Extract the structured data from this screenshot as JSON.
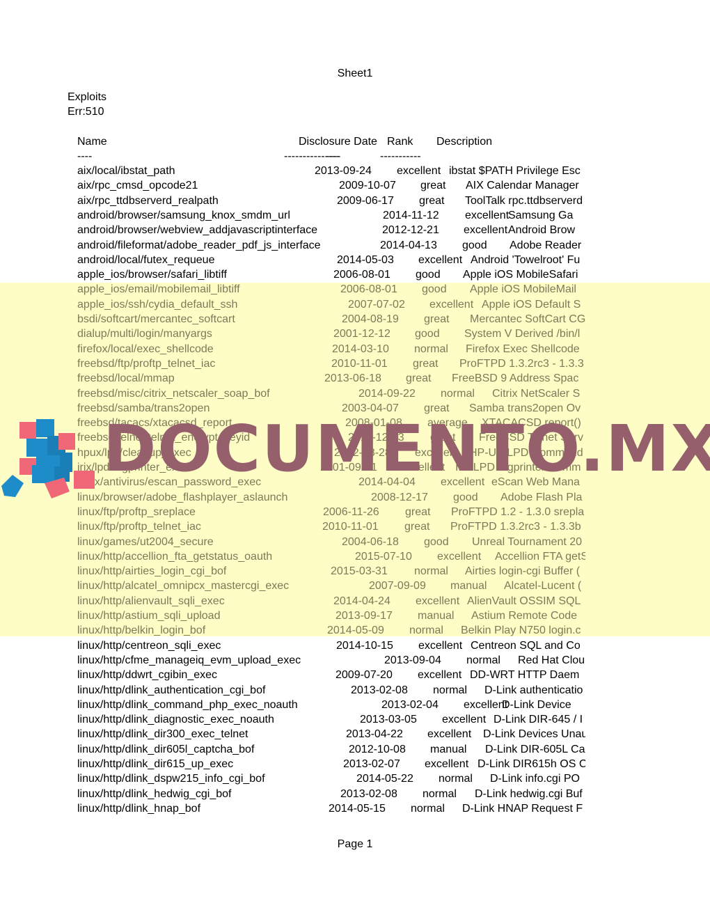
{
  "document": {
    "sheet_title": "Sheet1",
    "section_title": "Exploits",
    "error_cell": "Err:510",
    "footer": "Page 1",
    "highlight_color": "#fefdc6",
    "watermark": {
      "text": "DOCUMENTO.MX",
      "color": "#95606c",
      "logo": "stacked-cubes-logo"
    }
  },
  "table": {
    "headers": {
      "name": "Name",
      "date": "Disclosure Date",
      "rank": "Rank",
      "description": "Description"
    },
    "dashes": {
      "name": "----",
      "date": "---------------",
      "rank": "----",
      "description": "-----------"
    },
    "rows": [
      {
        "name": "aix/local/ibstat_path",
        "date": "2013-09-24",
        "rank": "excellent",
        "description": "ibstat $PATH Privilege Esc",
        "highlighted": false
      },
      {
        "name": "aix/rpc_cmsd_opcode21",
        "date": "2009-10-07",
        "rank": "great",
        "description": "AIX Calendar Manager",
        "highlighted": false
      },
      {
        "name": "aix/rpc_ttdbserverd_realpath",
        "date": "2009-06-17",
        "rank": "great",
        "description": "ToolTalk rpc.ttdbserverd",
        "highlighted": false
      },
      {
        "name": "android/browser/samsung_knox_smdm_url",
        "date": "2014-11-12",
        "rank": "excellent",
        "description": "Samsung Ga",
        "highlighted": false
      },
      {
        "name": "android/browser/webview_addjavascriptinterface",
        "date": "2012-12-21",
        "rank": "excellent",
        "description": "Android Brow",
        "highlighted": false
      },
      {
        "name": "android/fileformat/adobe_reader_pdf_js_interface",
        "date": "2014-04-13",
        "rank": "good",
        "description": "Adobe Reader",
        "highlighted": false
      },
      {
        "name": "android/local/futex_requeue",
        "date": "2014-05-03",
        "rank": "excellent",
        "description": "Android 'Towelroot' Fu",
        "highlighted": false
      },
      {
        "name": "apple_ios/browser/safari_libtiff",
        "date": "2006-08-01",
        "rank": "good",
        "description": "Apple iOS MobileSafari",
        "highlighted": false
      },
      {
        "name": "apple_ios/email/mobilemail_libtiff",
        "date": "2006-08-01",
        "rank": "good",
        "description": "Apple iOS MobileMail",
        "highlighted": true
      },
      {
        "name": "apple_ios/ssh/cydia_default_ssh",
        "date": "2007-07-02",
        "rank": "excellent",
        "description": "Apple iOS Default S",
        "highlighted": true
      },
      {
        "name": "bsdi/softcart/mercantec_softcart",
        "date": "2004-08-19",
        "rank": "great",
        "description": "Mercantec SoftCart CG",
        "highlighted": true
      },
      {
        "name": "dialup/multi/login/manyargs",
        "date": "2001-12-12",
        "rank": "good",
        "description": "System V Derived /bin/l",
        "highlighted": true
      },
      {
        "name": "firefox/local/exec_shellcode",
        "date": "2014-03-10",
        "rank": "normal",
        "description": "Firefox Exec Shellcode",
        "highlighted": true
      },
      {
        "name": "freebsd/ftp/proftp_telnet_iac",
        "date": "2010-11-01",
        "rank": "great",
        "description": "ProFTPD 1.3.2rc3 - 1.3.3",
        "highlighted": true
      },
      {
        "name": "freebsd/local/mmap",
        "date": "2013-06-18",
        "rank": "great",
        "description": "FreeBSD 9 Address Spac",
        "highlighted": true
      },
      {
        "name": "freebsd/misc/citrix_netscaler_soap_bof",
        "date": "2014-09-22",
        "rank": "normal",
        "description": "Citrix NetScaler S",
        "highlighted": true
      },
      {
        "name": "freebsd/samba/trans2open",
        "date": "2003-04-07",
        "rank": "great",
        "description": "Samba trans2open Ov",
        "highlighted": true
      },
      {
        "name": "freebsd/tacacs/xtacacsd_report",
        "date": "2008-01-08",
        "rank": "average",
        "description": "XTACACSD report()",
        "highlighted": true
      },
      {
        "name": "freebsd/telnet/telnet_encrypt_keyid",
        "date": "2011-12-23",
        "rank": "great",
        "description": "FreeBSD Telnet Serv",
        "highlighted": true
      },
      {
        "name": "hpux/lpd/cleanup_exec",
        "date": "2002-08-28",
        "rank": "excellent",
        "description": "HP-UX LPD Command",
        "highlighted": true
      },
      {
        "name": "irix/lpd/tagprinter_exec",
        "date": "2001-09-01",
        "rank": "excellent",
        "description": "Irix LPD tagprinter Comm",
        "highlighted": true
      },
      {
        "name": "linux/antivirus/escan_password_exec",
        "date": "2014-04-04",
        "rank": "excellent",
        "description": "eScan Web Mana",
        "highlighted": true
      },
      {
        "name": "linux/browser/adobe_flashplayer_aslaunch",
        "date": "2008-12-17",
        "rank": "good",
        "description": "Adobe Flash Pla",
        "highlighted": true
      },
      {
        "name": "linux/ftp/proftp_sreplace",
        "date": "2006-11-26",
        "rank": "great",
        "description": "ProFTPD 1.2 - 1.3.0 srepla",
        "highlighted": true
      },
      {
        "name": "linux/ftp/proftp_telnet_iac",
        "date": "2010-11-01",
        "rank": "great",
        "description": "ProFTPD 1.3.2rc3 - 1.3.3b",
        "highlighted": true
      },
      {
        "name": "linux/games/ut2004_secure",
        "date": "2004-06-18",
        "rank": "good",
        "description": "Unreal Tournament 20",
        "highlighted": true
      },
      {
        "name": "linux/http/accellion_fta_getstatus_oauth",
        "date": "2015-07-10",
        "rank": "excellent",
        "description": "Accellion FTA getS",
        "highlighted": true
      },
      {
        "name": "linux/http/airties_login_cgi_bof",
        "date": "2015-03-31",
        "rank": "normal",
        "description": "Airties login-cgi Buffer (",
        "highlighted": true
      },
      {
        "name": "linux/http/alcatel_omnipcx_mastercgi_exec",
        "date": "2007-09-09",
        "rank": "manual",
        "description": "Alcatel-Lucent (",
        "highlighted": true
      },
      {
        "name": "linux/http/alienvault_sqli_exec",
        "date": "2014-04-24",
        "rank": "excellent",
        "description": "AlienVault OSSIM SQL",
        "highlighted": true
      },
      {
        "name": "linux/http/astium_sqli_upload",
        "date": "2013-09-17",
        "rank": "manual",
        "description": "Astium Remote Code",
        "highlighted": true
      },
      {
        "name": "linux/http/belkin_login_bof",
        "date": "2014-05-09",
        "rank": "normal",
        "description": "Belkin Play N750 login.c",
        "highlighted": true
      },
      {
        "name": "linux/http/centreon_sqli_exec",
        "date": "2014-10-15",
        "rank": "excellent",
        "description": "Centreon SQL and Co",
        "highlighted": false
      },
      {
        "name": "linux/http/cfme_manageiq_evm_upload_exec",
        "date": "2013-09-04",
        "rank": "normal",
        "description": "Red Hat Clou",
        "highlighted": false
      },
      {
        "name": "linux/http/ddwrt_cgibin_exec",
        "date": "2009-07-20",
        "rank": "excellent",
        "description": "DD-WRT HTTP Daem",
        "highlighted": false
      },
      {
        "name": "linux/http/dlink_authentication_cgi_bof",
        "date": "2013-02-08",
        "rank": "normal",
        "description": "D-Link authenticatio",
        "highlighted": false
      },
      {
        "name": "linux/http/dlink_command_php_exec_noauth",
        "date": "2013-02-04",
        "rank": "excellent",
        "description": "D-Link Device",
        "highlighted": false
      },
      {
        "name": "linux/http/dlink_diagnostic_exec_noauth",
        "date": "2013-03-05",
        "rank": "excellent",
        "description": "D-Link DIR-645 / I",
        "highlighted": false
      },
      {
        "name": "linux/http/dlink_dir300_exec_telnet",
        "date": "2013-04-22",
        "rank": "excellent",
        "description": "D-Link Devices Unau",
        "highlighted": false
      },
      {
        "name": "linux/http/dlink_dir605l_captcha_bof",
        "date": "2012-10-08",
        "rank": "manual",
        "description": "D-Link DIR-605L Ca",
        "highlighted": false
      },
      {
        "name": "linux/http/dlink_dir615_up_exec",
        "date": "2013-02-07",
        "rank": "excellent",
        "description": "D-Link DIR615h OS C",
        "highlighted": false
      },
      {
        "name": "linux/http/dlink_dspw215_info_cgi_bof",
        "date": "2014-05-22",
        "rank": "normal",
        "description": "D-Link info.cgi PO",
        "highlighted": false
      },
      {
        "name": "linux/http/dlink_hedwig_cgi_bof",
        "date": "2013-02-08",
        "rank": "normal",
        "description": "D-Link hedwig.cgi Buf",
        "highlighted": false
      },
      {
        "name": "linux/http/dlink_hnap_bof",
        "date": "2014-05-15",
        "rank": "normal",
        "description": "D-Link HNAP Request F",
        "highlighted": false
      }
    ]
  }
}
